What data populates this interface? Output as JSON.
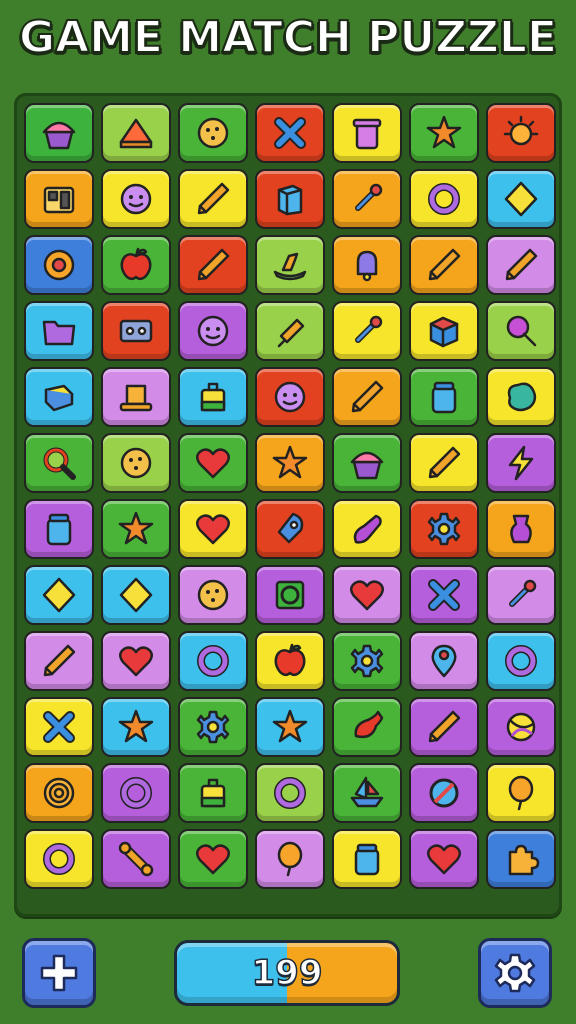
{
  "header": {
    "title": "GAME MATCH PUZZLE"
  },
  "board": {
    "rows": [
      [
        [
          "#3db33d",
          "cupcake-icon"
        ],
        [
          "#9ad14a",
          "cake-slice-icon"
        ],
        [
          "#49b437",
          "cookie-icon"
        ],
        [
          "#e2421f",
          "cross-icon"
        ],
        [
          "#f6e52a",
          "trash-can-icon"
        ],
        [
          "#49b437",
          "star-icon"
        ],
        [
          "#e2421f",
          "sun-icon"
        ]
      ],
      [
        [
          "#f5a51b",
          "radio-icon"
        ],
        [
          "#f6e52a",
          "face-icon"
        ],
        [
          "#f6e52a",
          "pencil-icon"
        ],
        [
          "#e2421f",
          "box-icon"
        ],
        [
          "#f5a51b",
          "pin-icon"
        ],
        [
          "#f6e52a",
          "ring-icon"
        ],
        [
          "#3dc0ec",
          "diamond-icon"
        ]
      ],
      [
        [
          "#3f7fdc",
          "flower-icon"
        ],
        [
          "#49b437",
          "apple-icon"
        ],
        [
          "#e2421f",
          "pencil-icon"
        ],
        [
          "#9ad14a",
          "duck-icon"
        ],
        [
          "#f5a51b",
          "bell-icon"
        ],
        [
          "#f5a51b",
          "pencil-icon"
        ],
        [
          "#d38be8",
          "pencil-icon"
        ]
      ],
      [
        [
          "#3dc0ec",
          "folder-icon"
        ],
        [
          "#e2421f",
          "cassette-icon"
        ],
        [
          "#b65fdc",
          "face-icon"
        ],
        [
          "#9ad14a",
          "ice-cream-icon"
        ],
        [
          "#f6e52a",
          "pin-icon"
        ],
        [
          "#f6e52a",
          "cube-icon"
        ],
        [
          "#9ad14a",
          "lollipop-icon"
        ]
      ],
      [
        [
          "#3dc0ec",
          "book-icon"
        ],
        [
          "#d38be8",
          "hat-icon"
        ],
        [
          "#3dc0ec",
          "bag-icon"
        ],
        [
          "#e2421f",
          "face-icon"
        ],
        [
          "#f5a51b",
          "pencil-icon"
        ],
        [
          "#49b437",
          "jar-icon"
        ],
        [
          "#f6e52a",
          "blob-icon"
        ]
      ],
      [
        [
          "#49b437",
          "magnifier-icon"
        ],
        [
          "#9ad14a",
          "cookie-icon"
        ],
        [
          "#49b437",
          "heart-icon"
        ],
        [
          "#f5a51b",
          "star-icon"
        ],
        [
          "#49b437",
          "cupcake-icon"
        ],
        [
          "#f6e52a",
          "pencil-icon"
        ],
        [
          "#b65fdc",
          "lightning-icon"
        ]
      ],
      [
        [
          "#b65fdc",
          "jar-icon"
        ],
        [
          "#49b437",
          "star-icon"
        ],
        [
          "#f6e52a",
          "heart-icon"
        ],
        [
          "#e2421f",
          "rocket-icon"
        ],
        [
          "#f6e52a",
          "eggplant-icon"
        ],
        [
          "#e2421f",
          "gear-icon"
        ],
        [
          "#f5a51b",
          "vase-icon"
        ]
      ],
      [
        [
          "#3dc0ec",
          "diamond-icon"
        ],
        [
          "#3dc0ec",
          "diamond-icon"
        ],
        [
          "#d38be8",
          "cookie-icon"
        ],
        [
          "#b65fdc",
          "square-ring-icon"
        ],
        [
          "#d38be8",
          "heart-icon"
        ],
        [
          "#b65fdc",
          "cross-icon"
        ],
        [
          "#d38be8",
          "pin-icon"
        ]
      ],
      [
        [
          "#d38be8",
          "pencil-icon"
        ],
        [
          "#d38be8",
          "heart-icon"
        ],
        [
          "#3dc0ec",
          "ring-icon"
        ],
        [
          "#f6e52a",
          "apple-icon"
        ],
        [
          "#49b437",
          "gear-icon"
        ],
        [
          "#d38be8",
          "map-pin-icon"
        ],
        [
          "#3dc0ec",
          "ring-icon"
        ]
      ],
      [
        [
          "#f6e52a",
          "cross-icon"
        ],
        [
          "#3dc0ec",
          "star-icon"
        ],
        [
          "#49b437",
          "gear-icon"
        ],
        [
          "#3dc0ec",
          "star-icon"
        ],
        [
          "#49b437",
          "pepper-icon"
        ],
        [
          "#b65fdc",
          "pencil-icon"
        ],
        [
          "#b65fdc",
          "ball-icon"
        ]
      ],
      [
        [
          "#f5a51b",
          "target-icon"
        ],
        [
          "#b65fdc",
          "ring-icon"
        ],
        [
          "#49b437",
          "bag-icon"
        ],
        [
          "#9ad14a",
          "ring-icon"
        ],
        [
          "#49b437",
          "ship-icon"
        ],
        [
          "#b65fdc",
          "no-sign-icon"
        ],
        [
          "#f6e52a",
          "balloon-icon"
        ]
      ],
      [
        [
          "#f6e52a",
          "ring-icon"
        ],
        [
          "#b65fdc",
          "bone-icon"
        ],
        [
          "#49b437",
          "heart-icon"
        ],
        [
          "#d38be8",
          "balloon-icon"
        ],
        [
          "#f6e52a",
          "jar-icon"
        ],
        [
          "#b65fdc",
          "heart-icon"
        ],
        [
          "#3f7fdc",
          "puzzle-icon"
        ]
      ]
    ]
  },
  "footer": {
    "plus_icon": "plus-icon",
    "score": "199",
    "settings_icon": "gear-icon"
  },
  "colors": {
    "background": "#3f7f2c",
    "board": "#2a5a1d",
    "button_blue": "#4f7be0",
    "score_left": "#3dc0ec",
    "score_right": "#f5a51b"
  }
}
